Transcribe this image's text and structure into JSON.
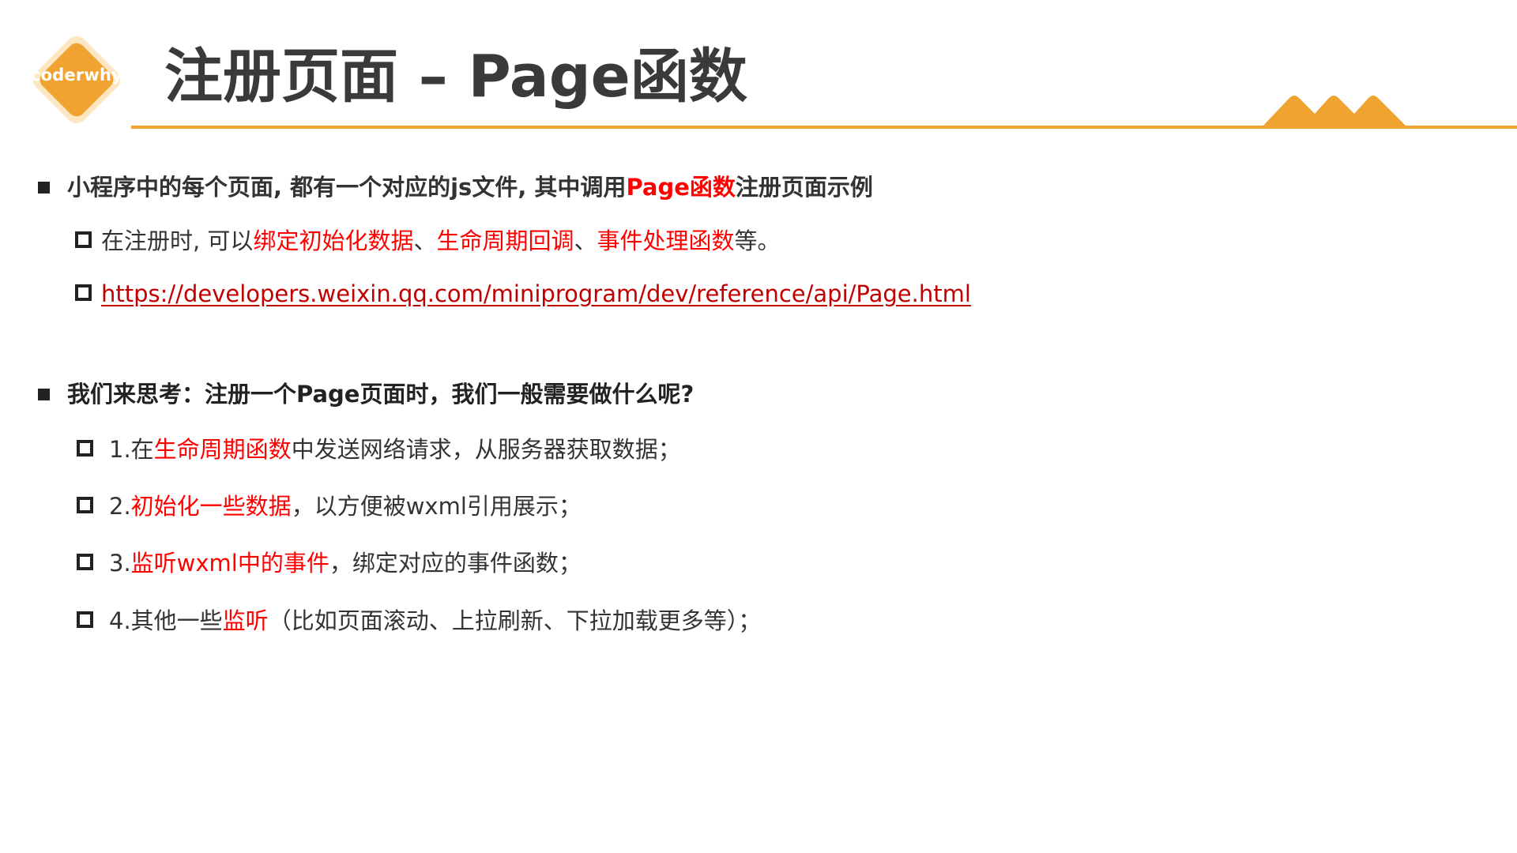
{
  "logo": {
    "text": "coderwhy"
  },
  "header": {
    "title": "注册页面 – Page函数"
  },
  "colors": {
    "accent_orange": "#f0a330",
    "highlight_red": "#ff0000",
    "link_red": "#c00000",
    "text_dark": "#333333"
  },
  "intro": {
    "heading": {
      "before": "小程序中的每个页面, 都有一个对应的js文件, 其中调用",
      "highlight": "Page函数",
      "after": "注册页面示例"
    },
    "sub1": {
      "before": "在注册时, 可以",
      "hl1": "绑定初始化数据",
      "sep1": "、",
      "hl2": "生命周期回调",
      "sep2": "、",
      "hl3": "事件处理函数",
      "after": "等。"
    },
    "link": "https://developers.weixin.qq.com/miniprogram/dev/reference/api/Page.html"
  },
  "think": {
    "heading": "我们来思考：注册一个Page页面时，我们一般需要做什么呢?",
    "items": [
      {
        "before": "1.在",
        "highlight": "生命周期函数",
        "after": "中发送网络请求，从服务器获取数据；"
      },
      {
        "before": "2.",
        "highlight": "初始化一些数据",
        "after": "，以方便被wxml引用展示；"
      },
      {
        "before": "3.",
        "highlight": "监听wxml中的事件",
        "after": "，绑定对应的事件函数；"
      },
      {
        "before": "4.其他一些",
        "highlight": "监听",
        "after": "（比如页面滚动、上拉刷新、下拉加载更多等）；"
      }
    ]
  }
}
